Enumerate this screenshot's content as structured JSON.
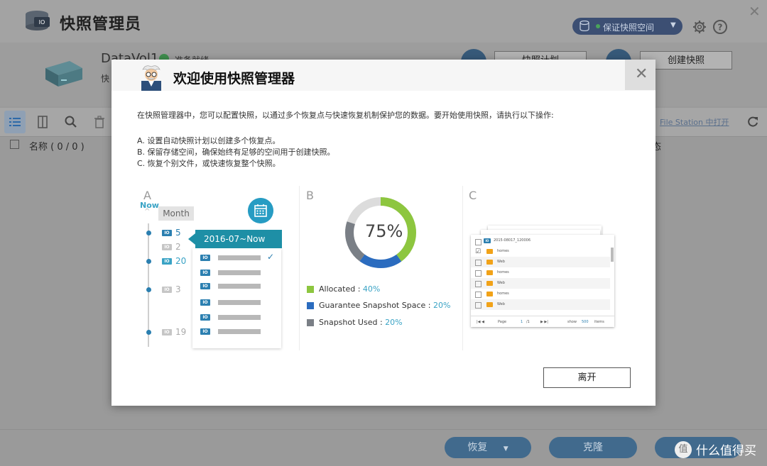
{
  "app": {
    "title": "快照管理员",
    "storage_pill": "保证快照空间",
    "volume_name": "DataVol1",
    "volume_status": "准备就绪",
    "volume_sub": "快",
    "schedule_button": "快照计划",
    "create_button": "创建快照",
    "file_station_link": "File Station 中打开",
    "col_name": "名称 ( 0 / 0 )",
    "col_state": "态",
    "footer": {
      "restore": "恢复",
      "clone": "克隆"
    },
    "watermark": "什么值得买",
    "watermark_logo": "值"
  },
  "modal": {
    "title": "欢迎使用快照管理器",
    "intro": "在快照管理器中，您可以配置快照，以通过多个恢复点与快速恢复机制保护您的数据。要开始使用快照，请执行以下操作:",
    "steps": [
      "A. 设置自动快照计划以创建多个恢复点。",
      "B. 保留存储空间，确保始终有足够的空间用于创建快照。",
      "C. 恢复个别文件，或快速恢复整个快照。"
    ],
    "leave_button": "离开"
  },
  "panel_a": {
    "letter": "A",
    "now": "Now",
    "month": "Month",
    "date_range": "2016-07~Now",
    "timeline": [
      {
        "count": "5",
        "active": true
      },
      {
        "count": "2",
        "active": false
      },
      {
        "count": "20",
        "active": true
      },
      {
        "count": "3",
        "active": false
      },
      {
        "count": "19",
        "active": false
      }
    ],
    "io_label": "IO"
  },
  "panel_b": {
    "letter": "B",
    "percent_label": "75%",
    "chart_data": {
      "type": "pie",
      "categories": [
        "Allocated",
        "Guarantee Snapshot Space",
        "Snapshot Used"
      ],
      "values": [
        40,
        20,
        20
      ],
      "colors": [
        "#8dc63f",
        "#2b6cbf",
        "#7a7f86"
      ]
    },
    "legend": [
      {
        "label": "Allocated : ",
        "value": "40%"
      },
      {
        "label": "Guarantee Snapshot Space : ",
        "value": "20%"
      },
      {
        "label": "Snapshot Used : ",
        "value": "20%"
      }
    ]
  },
  "panel_c": {
    "letter": "C",
    "snapshot_name": "2015-08017_120006",
    "folders": [
      "homes",
      "Web",
      "homes",
      "Web",
      "homes",
      "Web"
    ],
    "pager": {
      "page": "Page",
      "page_num": "1",
      "page_total": "/1",
      "show": "show",
      "per_page": "500",
      "items": "items"
    }
  },
  "colors": {
    "accent_blue": "#1e8fa6",
    "timeline_blue": "#2b7fb0",
    "allocated": "#8dc63f",
    "guarantee": "#2b6cbf",
    "used": "#7a7f86"
  }
}
